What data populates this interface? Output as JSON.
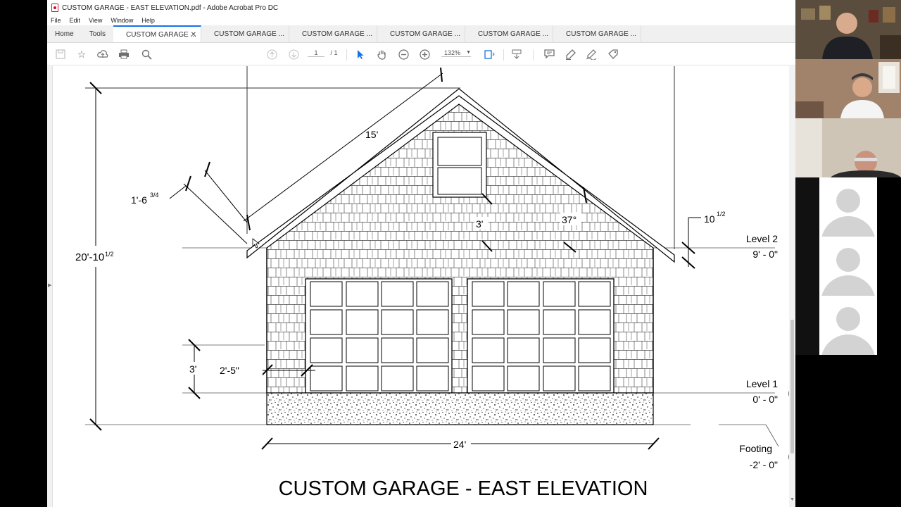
{
  "window": {
    "title": "CUSTOM GARAGE - EAST ELEVATION.pdf - Adobe Acrobat Pro DC"
  },
  "menu": [
    "File",
    "Edit",
    "View",
    "Window",
    "Help"
  ],
  "nav": {
    "home": "Home",
    "tools": "Tools"
  },
  "tabs": [
    {
      "label": "CUSTOM GARAGE ...",
      "active": true
    },
    {
      "label": "CUSTOM GARAGE ...",
      "active": false
    },
    {
      "label": "CUSTOM GARAGE ...",
      "active": false
    },
    {
      "label": "CUSTOM GARAGE ...",
      "active": false
    },
    {
      "label": "CUSTOM GARAGE ...",
      "active": false
    },
    {
      "label": "CUSTOM GARAGE ...",
      "active": false
    }
  ],
  "toolbar": {
    "page_current": "1",
    "page_total": "/ 1",
    "zoom": "132%",
    "icons": [
      "save-icon",
      "star-icon",
      "upload-icon",
      "print-icon",
      "find-icon",
      "prev-page-icon",
      "next-page-icon",
      "select-icon",
      "hand-icon",
      "zoom-out-icon",
      "zoom-in-icon",
      "fit-page-icon",
      "scroll-mode-icon",
      "comment-icon",
      "highlight-icon",
      "sign-icon",
      "fill-sign-icon"
    ]
  },
  "drawing": {
    "title": "CUSTOM GARAGE - EAST ELEVATION",
    "dims": {
      "total_height": "20'-10",
      "total_height_frac": "1/2",
      "roof_len": "15'",
      "overhang": "1'-6",
      "overhang_frac": "3/4",
      "wall_right": "10",
      "wall_right_frac": "1/2",
      "window_offset": "3'",
      "angle": "37°",
      "sill": "3'",
      "door_offset": "2'-5\"",
      "width": "24'"
    },
    "levels": [
      {
        "name": "Level 2",
        "elev": "9' - 0\""
      },
      {
        "name": "Level 1",
        "elev": "0' - 0\""
      },
      {
        "name": "Footing",
        "elev": "-2' - 0\""
      }
    ]
  },
  "colors": {
    "accent": "#1473e6",
    "pdf_red": "#c8102e"
  }
}
